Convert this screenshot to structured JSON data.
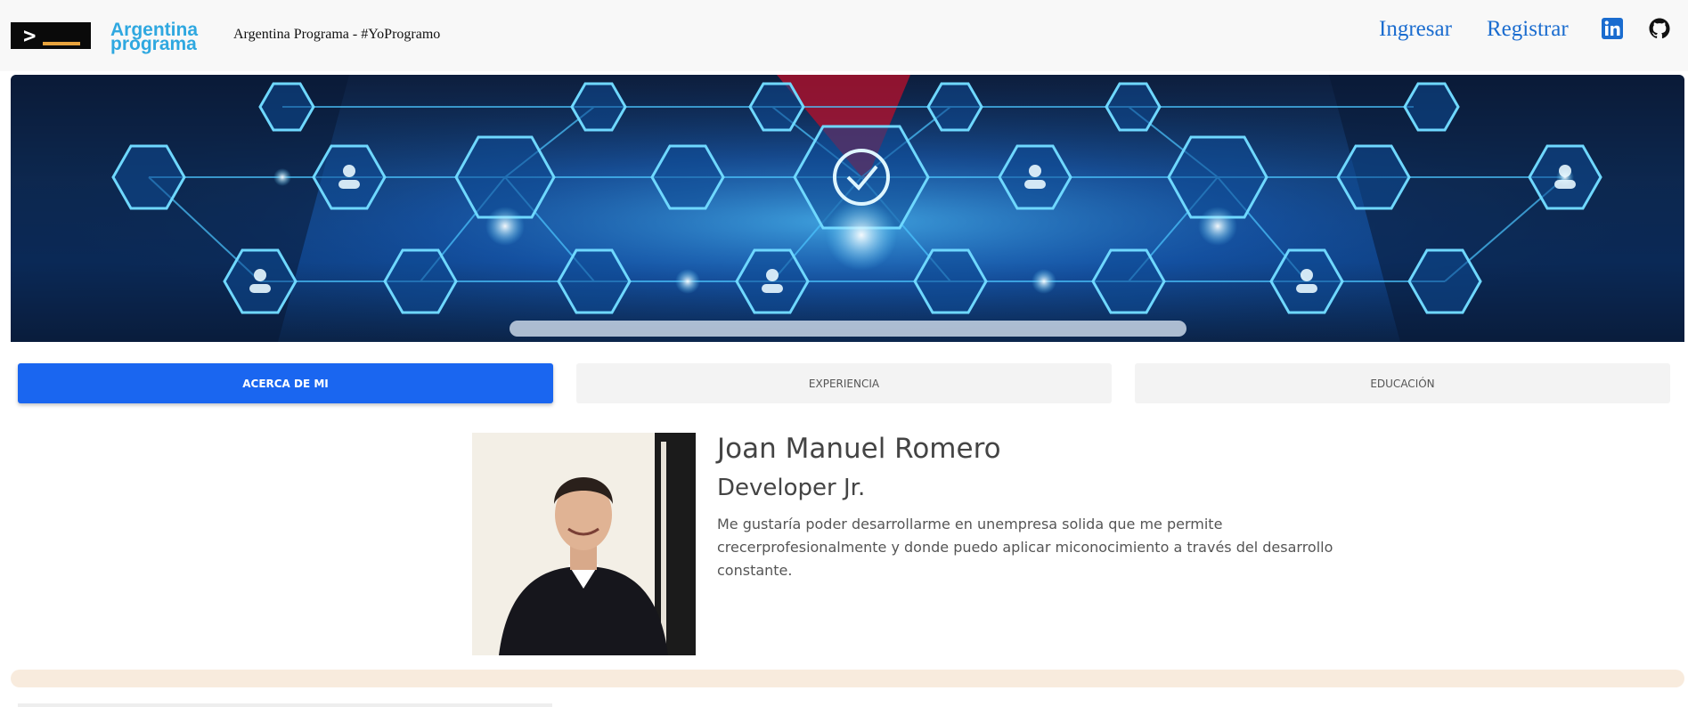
{
  "navbar": {
    "logo_prompt": ">",
    "logo_text_line1": "Argentina",
    "logo_text_line2": "programa",
    "brand": "Argentina Programa - #YoProgramo",
    "login_label": "Ingresar",
    "register_label": "Registrar",
    "icons": [
      "linkedin-icon",
      "github-icon"
    ]
  },
  "tabs": [
    {
      "label": "ACERCA DE MI",
      "active": true
    },
    {
      "label": "EXPERIENCIA",
      "active": false
    },
    {
      "label": "EDUCACIÓN",
      "active": false
    }
  ],
  "profile": {
    "name": "Joan Manuel Romero",
    "role": "Developer Jr.",
    "bio": "Me gustaría poder desarrollarme en unempresa solida que me permite crecerprofesionalmente y donde puedo aplicar miconocimiento a través del desarrollo constante."
  },
  "colors": {
    "accent": "#1a66f0",
    "link": "#1a6ccf",
    "logo_blue": "#2fa8e0",
    "skills_bar": "#f8ebdd"
  }
}
